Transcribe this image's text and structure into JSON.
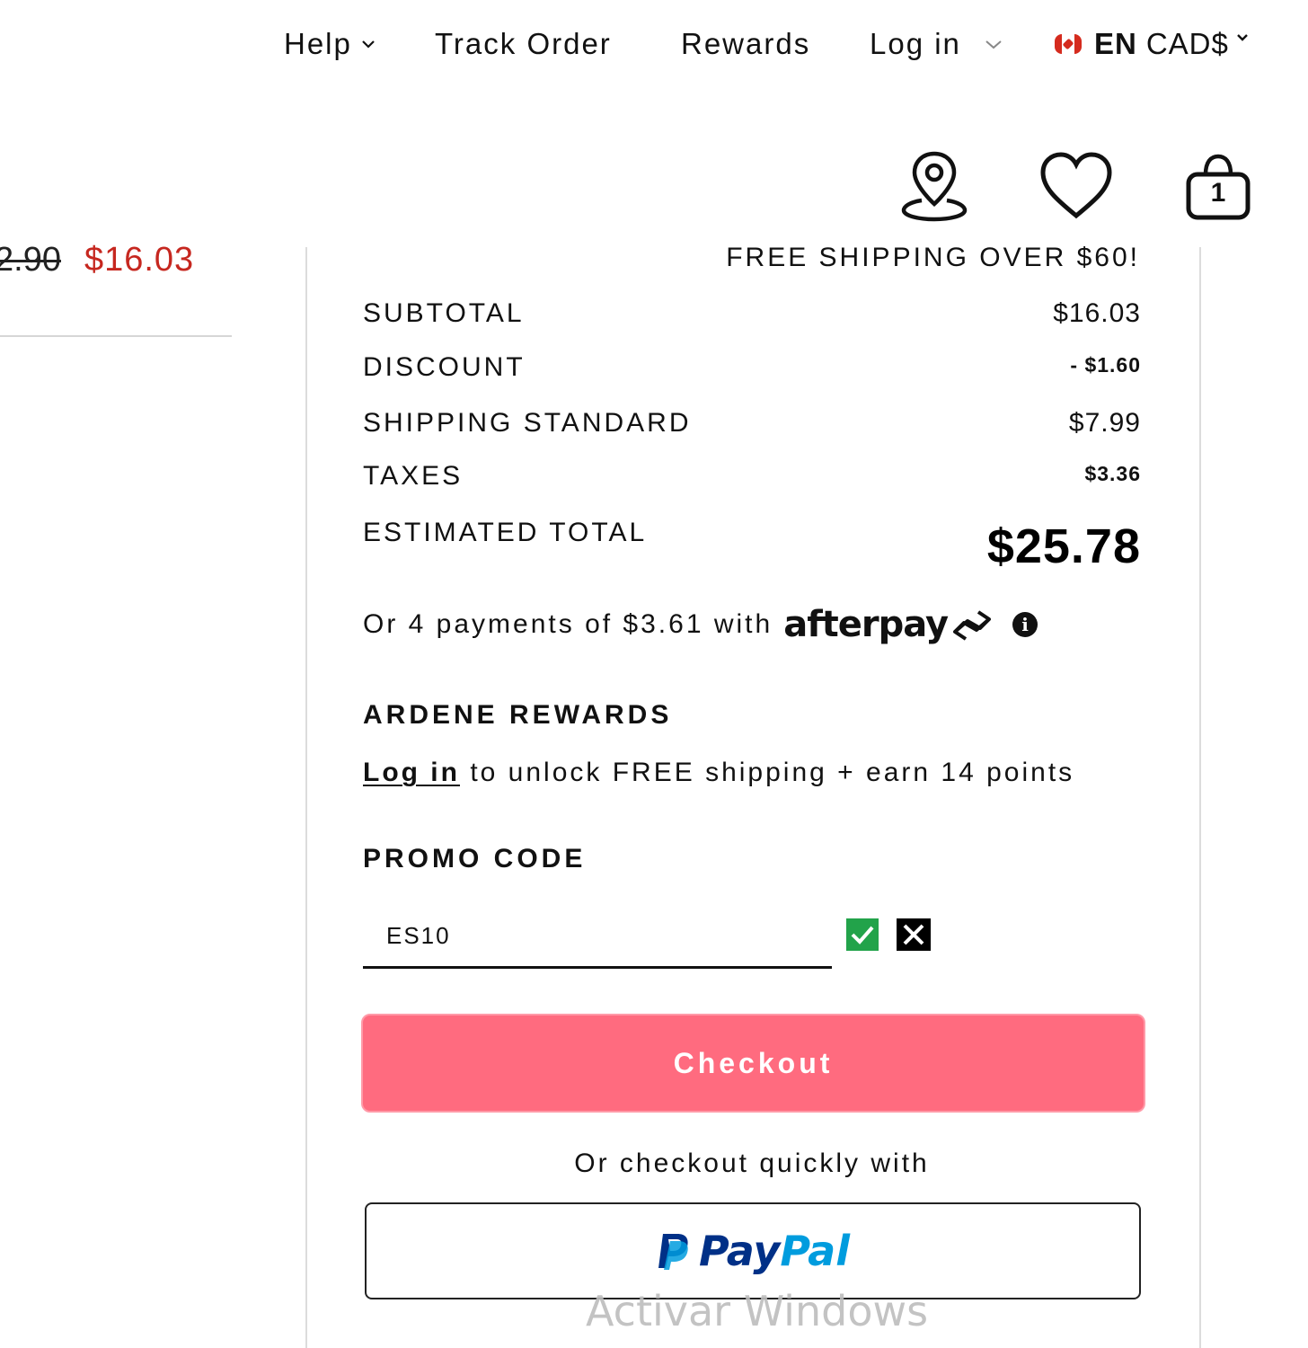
{
  "topnav": {
    "help": "Help",
    "track_order": "Track Order",
    "rewards": "Rewards",
    "log_in": "Log in",
    "language": "EN",
    "currency": "CAD$"
  },
  "header_icons": {
    "store_locator": "map-pin-icon",
    "wishlist": "heart-icon",
    "cart": "shopping-bag-icon",
    "cart_count": "1"
  },
  "item": {
    "original_price_partial": "2.90",
    "sale_price": "$16.03"
  },
  "summary": {
    "free_shipping_banner": "FREE SHIPPING OVER $60!",
    "rows": [
      {
        "label": "SUBTOTAL",
        "value": "$16.03"
      },
      {
        "label": "DISCOUNT",
        "value": "- $1.60"
      },
      {
        "label": "SHIPPING STANDARD",
        "value": "$7.99"
      },
      {
        "label": "TAXES",
        "value": "$3.36"
      }
    ],
    "total_label": "ESTIMATED TOTAL",
    "total_value": "$25.78"
  },
  "afterpay": {
    "text": "Or 4 payments of $3.61 with",
    "logo": "afterpay"
  },
  "rewards": {
    "heading": "ARDENE REWARDS",
    "login_link": "Log in",
    "text": " to unlock FREE shipping + earn 14 points"
  },
  "promo": {
    "heading": "PROMO CODE",
    "value": "ES10"
  },
  "checkout": {
    "label": "Checkout",
    "quick_text": "Or checkout quickly with",
    "paypal_pay": "Pay",
    "paypal_pal": "Pal"
  },
  "watermark": "Activar Windows",
  "colors": {
    "sale_red": "#c6271f",
    "checkout_pink": "#ff6b7f",
    "apply_green": "#22a34a",
    "paypal_dark": "#003087",
    "paypal_light": "#009cde"
  }
}
